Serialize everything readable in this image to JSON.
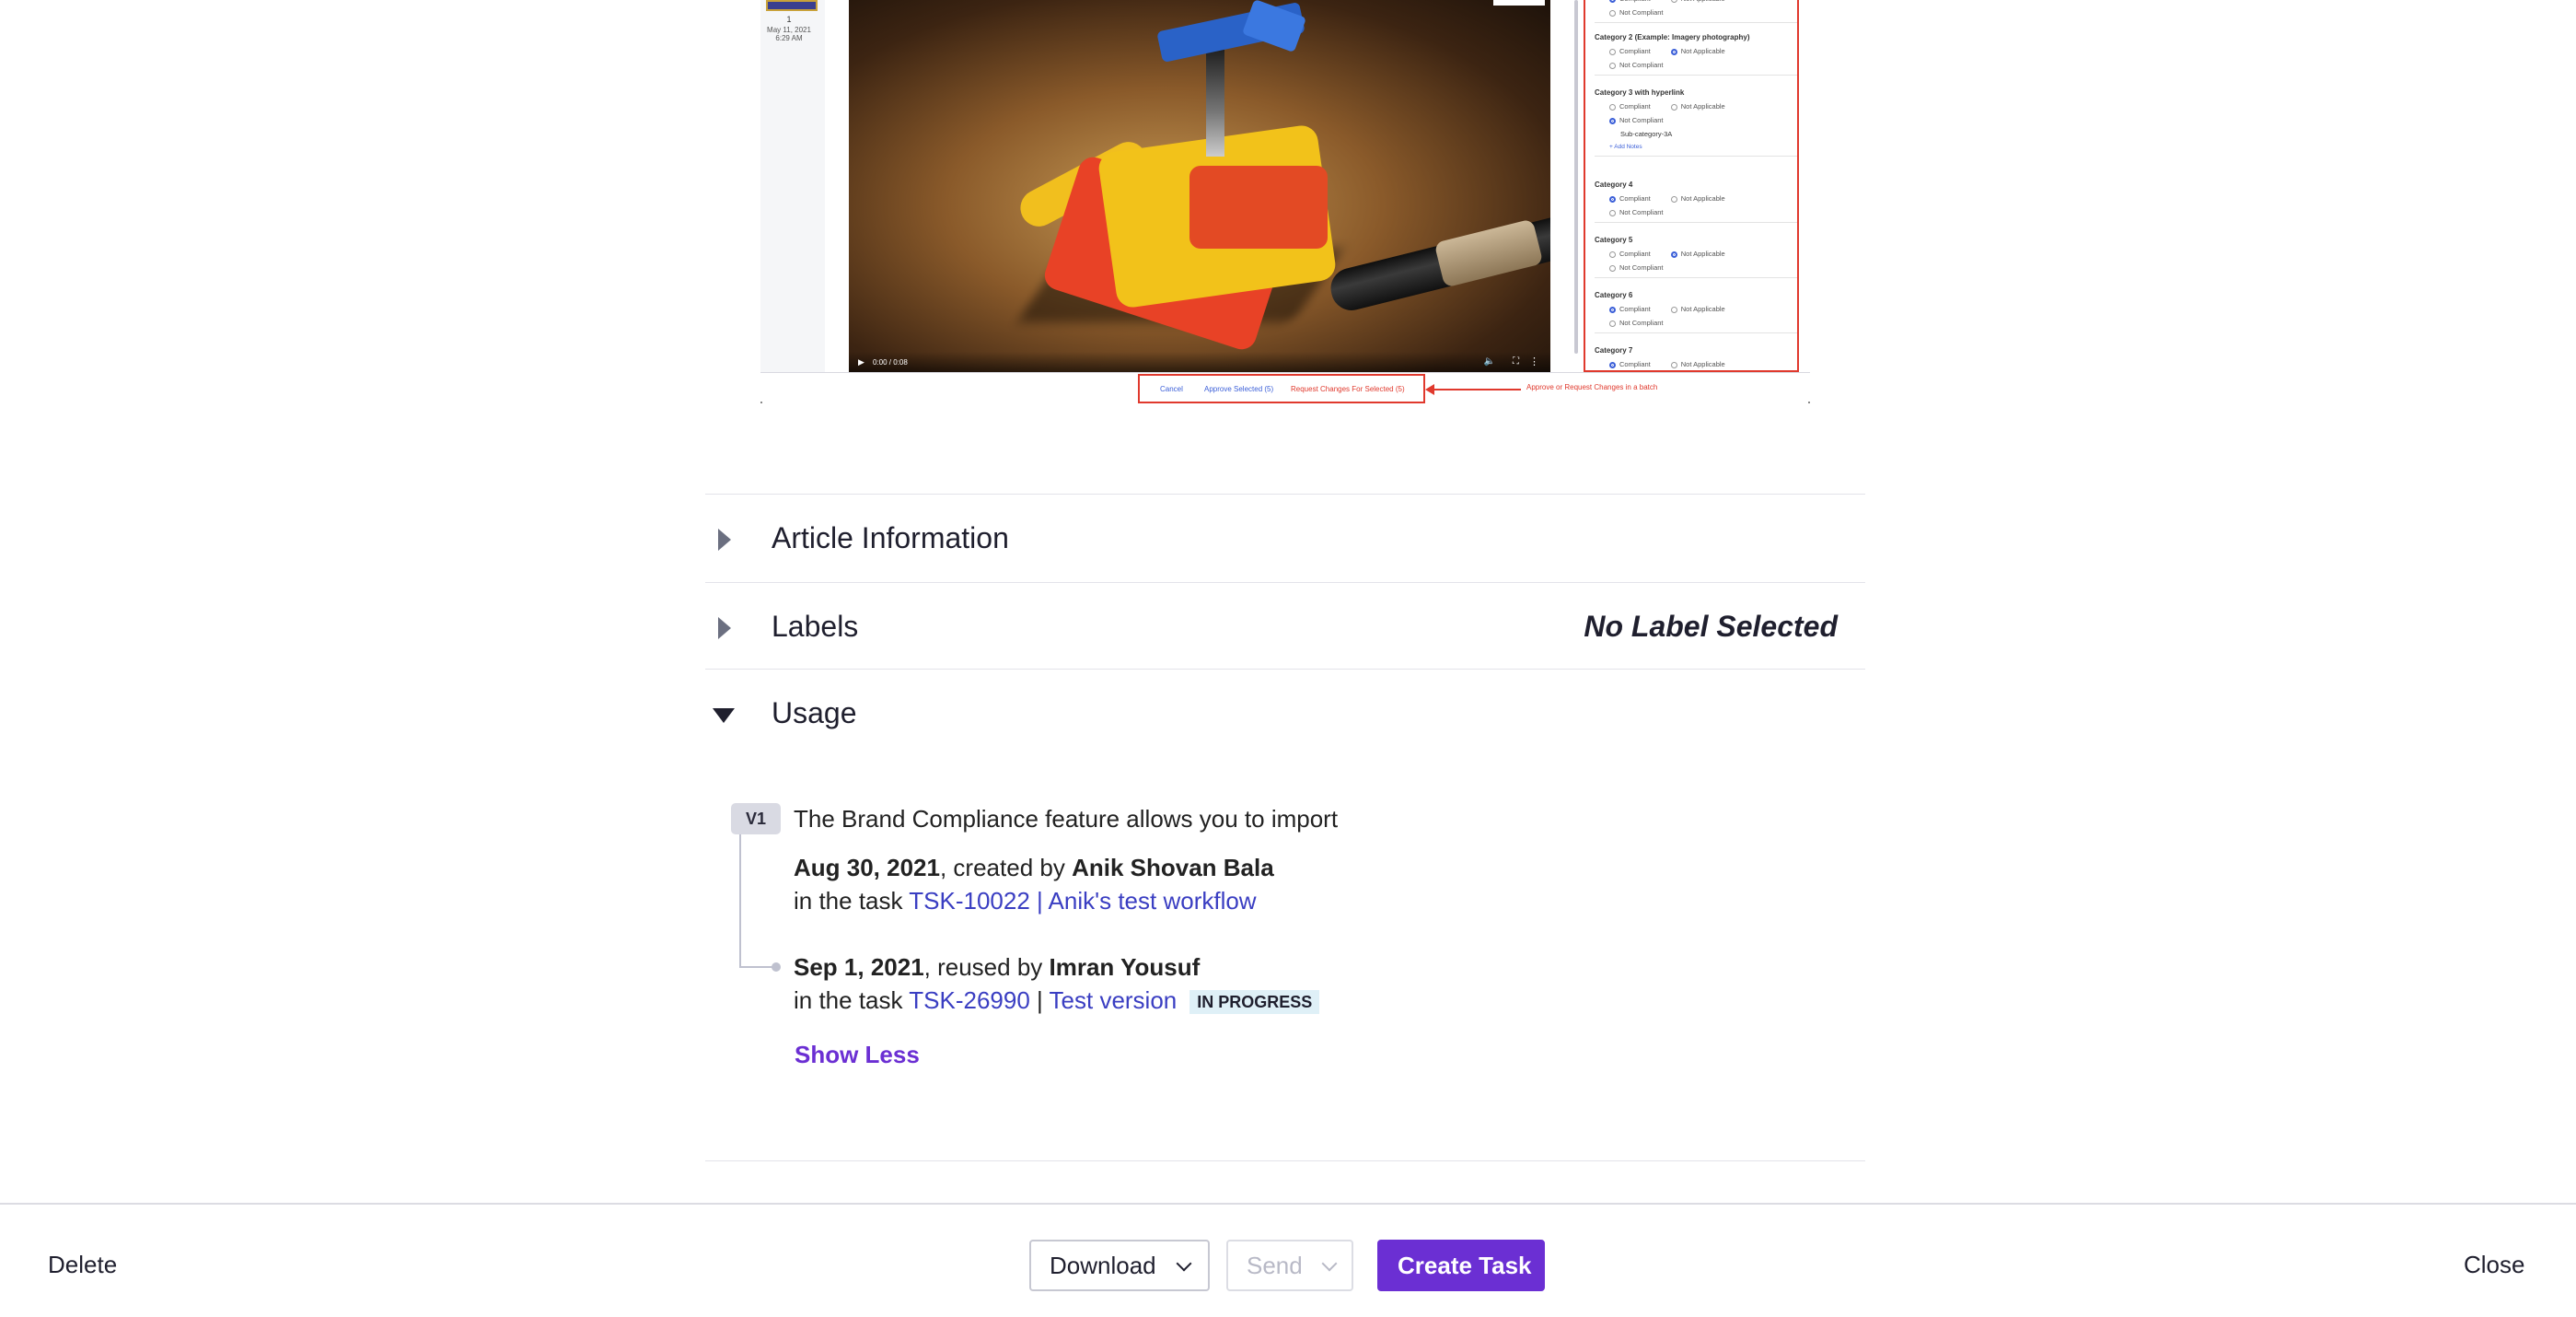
{
  "preview": {
    "thumb_number": "1",
    "thumb_date": "May 11, 2021",
    "thumb_time": "6:29 AM",
    "video_time": "0:00 / 0:08",
    "checklist": [
      {
        "title": "",
        "options": [
          "Compliant",
          "Not Applicable",
          "Not Compliant"
        ],
        "selected": 0
      },
      {
        "title": "Category 2 (Example: Imagery photography)",
        "options": [
          "Compliant",
          "Not Applicable",
          "Not Compliant"
        ],
        "selected": 1
      },
      {
        "title": "Category 3 with hyperlink",
        "options": [
          "Compliant",
          "Not Applicable",
          "Not Compliant"
        ],
        "selected": 2,
        "sub": "Sub-category-3A",
        "add": "+ Add Notes"
      },
      {
        "title": "Category 4",
        "options": [
          "Compliant",
          "Not Applicable",
          "Not Compliant"
        ],
        "selected": 0
      },
      {
        "title": "Category 5",
        "options": [
          "Compliant",
          "Not Applicable",
          "Not Compliant"
        ],
        "selected": 1
      },
      {
        "title": "Category 6",
        "options": [
          "Compliant",
          "Not Applicable",
          "Not Compliant"
        ],
        "selected": 0
      },
      {
        "title": "Category 7",
        "options": [
          "Compliant",
          "Not Applicable"
        ],
        "selected": 0
      }
    ],
    "batch": {
      "cancel": "Cancel",
      "approve": "Approve Selected (5)",
      "request": "Request Changes For Selected (5)",
      "note": "Approve or Request Changes in a batch"
    }
  },
  "sections": {
    "article": {
      "title": "Article Information"
    },
    "labels": {
      "title": "Labels",
      "value": "No Label Selected"
    },
    "usage": {
      "title": "Usage"
    }
  },
  "usage": {
    "version": "V1",
    "description": "The Brand Compliance feature allows you to import",
    "entries": [
      {
        "date": "Aug 30, 2021",
        "action": ", created by ",
        "user": "Anik Shovan Bala",
        "prefix": "in the task ",
        "task": "TSK-10022 | Anik's test workflow"
      },
      {
        "date": "Sep 1, 2021",
        "action": ", reused by ",
        "user": "Imran Yousuf",
        "prefix": "in the task ",
        "task_id": "TSK-26990",
        "separator": " | ",
        "task_name": "Test version",
        "status": "IN PROGRESS"
      }
    ],
    "show_less": "Show Less"
  },
  "footer": {
    "delete": "Delete",
    "download": "Download",
    "send": "Send",
    "create_task": "Create Task",
    "close": "Close"
  }
}
